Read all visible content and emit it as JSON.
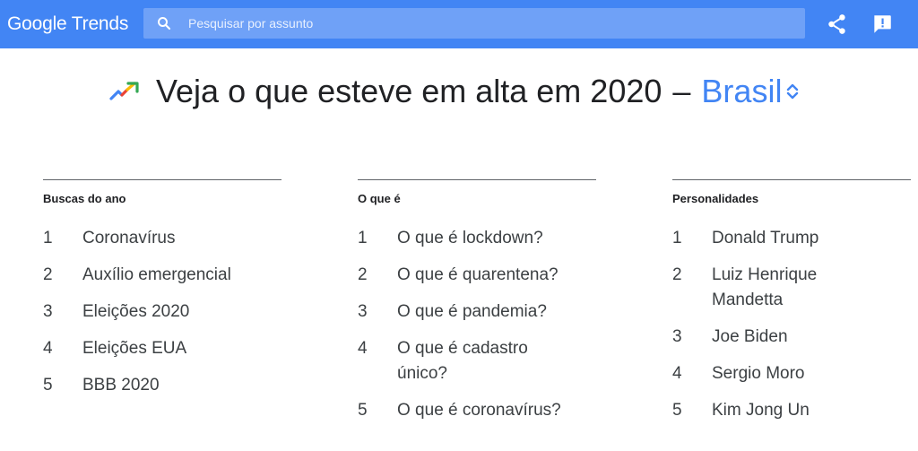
{
  "header": {
    "logo_google": "Google",
    "logo_trends": "Trends",
    "search_placeholder": "Pesquisar por assunto",
    "share_icon": "share-icon",
    "feedback_icon": "feedback-icon",
    "bar_color": "#4285f4"
  },
  "headline": {
    "text": "Veja o que esteve em alta em 2020",
    "dash": "–",
    "region": "Brasil",
    "region_color": "#4285f4"
  },
  "columns": [
    {
      "title": "Buscas do ano",
      "items": [
        {
          "rank": "1",
          "label": "Coronavírus"
        },
        {
          "rank": "2",
          "label": "Auxílio emergencial"
        },
        {
          "rank": "3",
          "label": "Eleições 2020"
        },
        {
          "rank": "4",
          "label": "Eleições EUA"
        },
        {
          "rank": "5",
          "label": "BBB 2020"
        }
      ]
    },
    {
      "title": "O que é",
      "items": [
        {
          "rank": "1",
          "label": "O que é lockdown?"
        },
        {
          "rank": "2",
          "label": "O que é quarentena?"
        },
        {
          "rank": "3",
          "label": "O que é pandemia?"
        },
        {
          "rank": "4",
          "label": "O que é cadastro único?"
        },
        {
          "rank": "5",
          "label": "O que é coronavírus?"
        }
      ]
    },
    {
      "title": "Personalidades",
      "items": [
        {
          "rank": "1",
          "label": "Donald Trump"
        },
        {
          "rank": "2",
          "label": "Luiz Henrique Mandetta"
        },
        {
          "rank": "3",
          "label": "Joe Biden"
        },
        {
          "rank": "4",
          "label": "Sergio Moro"
        },
        {
          "rank": "5",
          "label": "Kim Jong Un"
        }
      ]
    }
  ]
}
